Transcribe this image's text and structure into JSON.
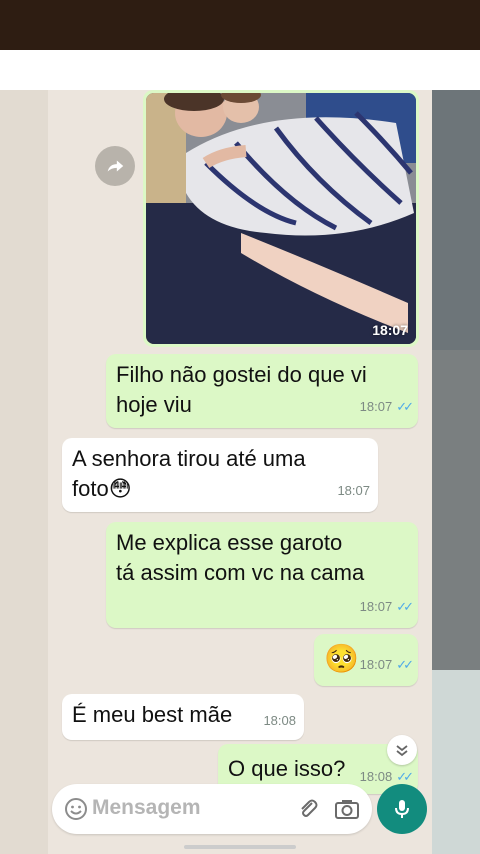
{
  "photo_message": {
    "time": "18:07"
  },
  "messages": [
    {
      "dir": "out",
      "lines": [
        "Filho não gostei do que vi",
        "hoje viu"
      ],
      "time": "18:07",
      "ticks": "✓✓"
    },
    {
      "dir": "in",
      "lines": [
        "A senhora tirou até uma",
        "foto😳"
      ],
      "time": "18:07"
    },
    {
      "dir": "out",
      "lines": [
        "Me explica esse garoto",
        "tá assim com vc na cama"
      ],
      "time": "18:07",
      "ticks": "✓✓"
    },
    {
      "dir": "out",
      "lines": [
        "🥺"
      ],
      "time": "18:07",
      "ticks": "✓✓"
    },
    {
      "dir": "in",
      "lines": [
        "É meu best mãe"
      ],
      "time": "18:08"
    },
    {
      "dir": "out",
      "lines": [
        "O que isso?"
      ],
      "time": "18:08",
      "ticks": "✓✓"
    }
  ],
  "composer": {
    "placeholder": "Mensagem"
  },
  "icons": {
    "forward": "forward-icon",
    "scroll_down": "chevron-down-icon",
    "emoji": "emoji-icon",
    "attach": "paperclip-icon",
    "camera": "camera-icon",
    "mic": "microphone-icon"
  },
  "colors": {
    "outgoing_bubble": "#dcf8c6",
    "incoming_bubble": "#ffffff",
    "read_ticks": "#4fa9e8",
    "mic_button": "#128c7e"
  }
}
